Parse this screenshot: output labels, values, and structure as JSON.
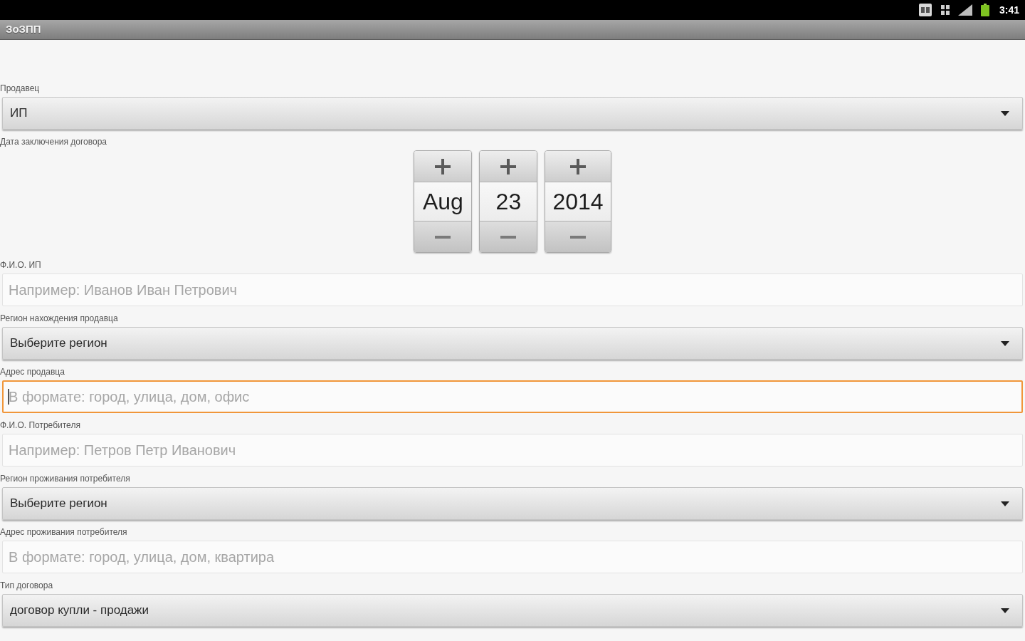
{
  "status_bar": {
    "time": "3:41"
  },
  "title_bar": {
    "title": "ЗоЗПП"
  },
  "form": [
    {
      "kind": "spinner",
      "label": "Продавец",
      "value": "ИП"
    },
    {
      "kind": "date",
      "label": "Дата заключения договора",
      "columns": [
        {
          "value": "Aug"
        },
        {
          "value": "23"
        },
        {
          "value": "2014"
        }
      ]
    },
    {
      "kind": "input",
      "label": "Ф.И.О. ИП",
      "placeholder": "Например: Иванов Иван Петрович",
      "focused": false
    },
    {
      "kind": "spinner",
      "label": "Регион нахождения продавца",
      "value": "Выберите регион"
    },
    {
      "kind": "input",
      "label": "Адрес продавца",
      "placeholder": "В формате: город, улица, дом, офис",
      "focused": true
    },
    {
      "kind": "input",
      "label": "Ф.И.О. Потребителя",
      "placeholder": "Например: Петров Петр Иванович",
      "focused": false
    },
    {
      "kind": "spinner",
      "label": "Регион проживания потребителя",
      "value": "Выберите регион"
    },
    {
      "kind": "input",
      "label": "Адрес проживания потребителя",
      "placeholder": "В формате: город, улица, дом, квартира",
      "focused": false
    },
    {
      "kind": "spinner",
      "label": "Тип договора",
      "value": "договор купли - продажи"
    }
  ]
}
